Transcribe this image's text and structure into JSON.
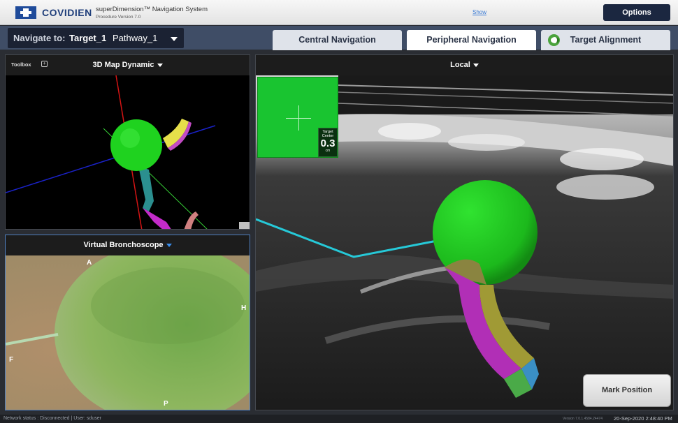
{
  "header": {
    "brand": "COVIDIEN",
    "system_title": "superDimension™ Navigation System",
    "procedure_version": "Procedure Version 7.0",
    "show_link": "Show",
    "options_label": "Options"
  },
  "navbar": {
    "navigate_label": "Navigate to:",
    "target": "Target_1",
    "pathway": "Pathway_1",
    "tabs": [
      {
        "label": "Central Navigation",
        "active": false
      },
      {
        "label": "Peripheral Navigation",
        "active": true
      },
      {
        "label": "Target Alignment",
        "active": false
      }
    ]
  },
  "map_panel": {
    "toolbox_label": "Toolbox",
    "toolbox_icon": "+",
    "title": "3D Map Dynamic"
  },
  "vb_panel": {
    "title": "Virtual Bronchoscope",
    "orientation": {
      "top": "A",
      "right": "H",
      "left": "F",
      "bottom": "P"
    }
  },
  "local_panel": {
    "title": "Local",
    "target_center": {
      "label_line1": "Target",
      "label_line2": "Center",
      "value": "0.3",
      "unit": "cm"
    },
    "mark_position_label": "Mark Position"
  },
  "statusbar": {
    "network_status": "Network status : Disconnected",
    "user": "User:  sduser",
    "version": "Version 7.0.1.4584.24474",
    "datetime": "20-Sep-2020 2:48:40 PM"
  },
  "colors": {
    "brand_blue": "#1f4b9a",
    "nav_bar": "#3f4d66",
    "target_green": "#19c430",
    "vb_highlight": "#3a8ff0"
  }
}
